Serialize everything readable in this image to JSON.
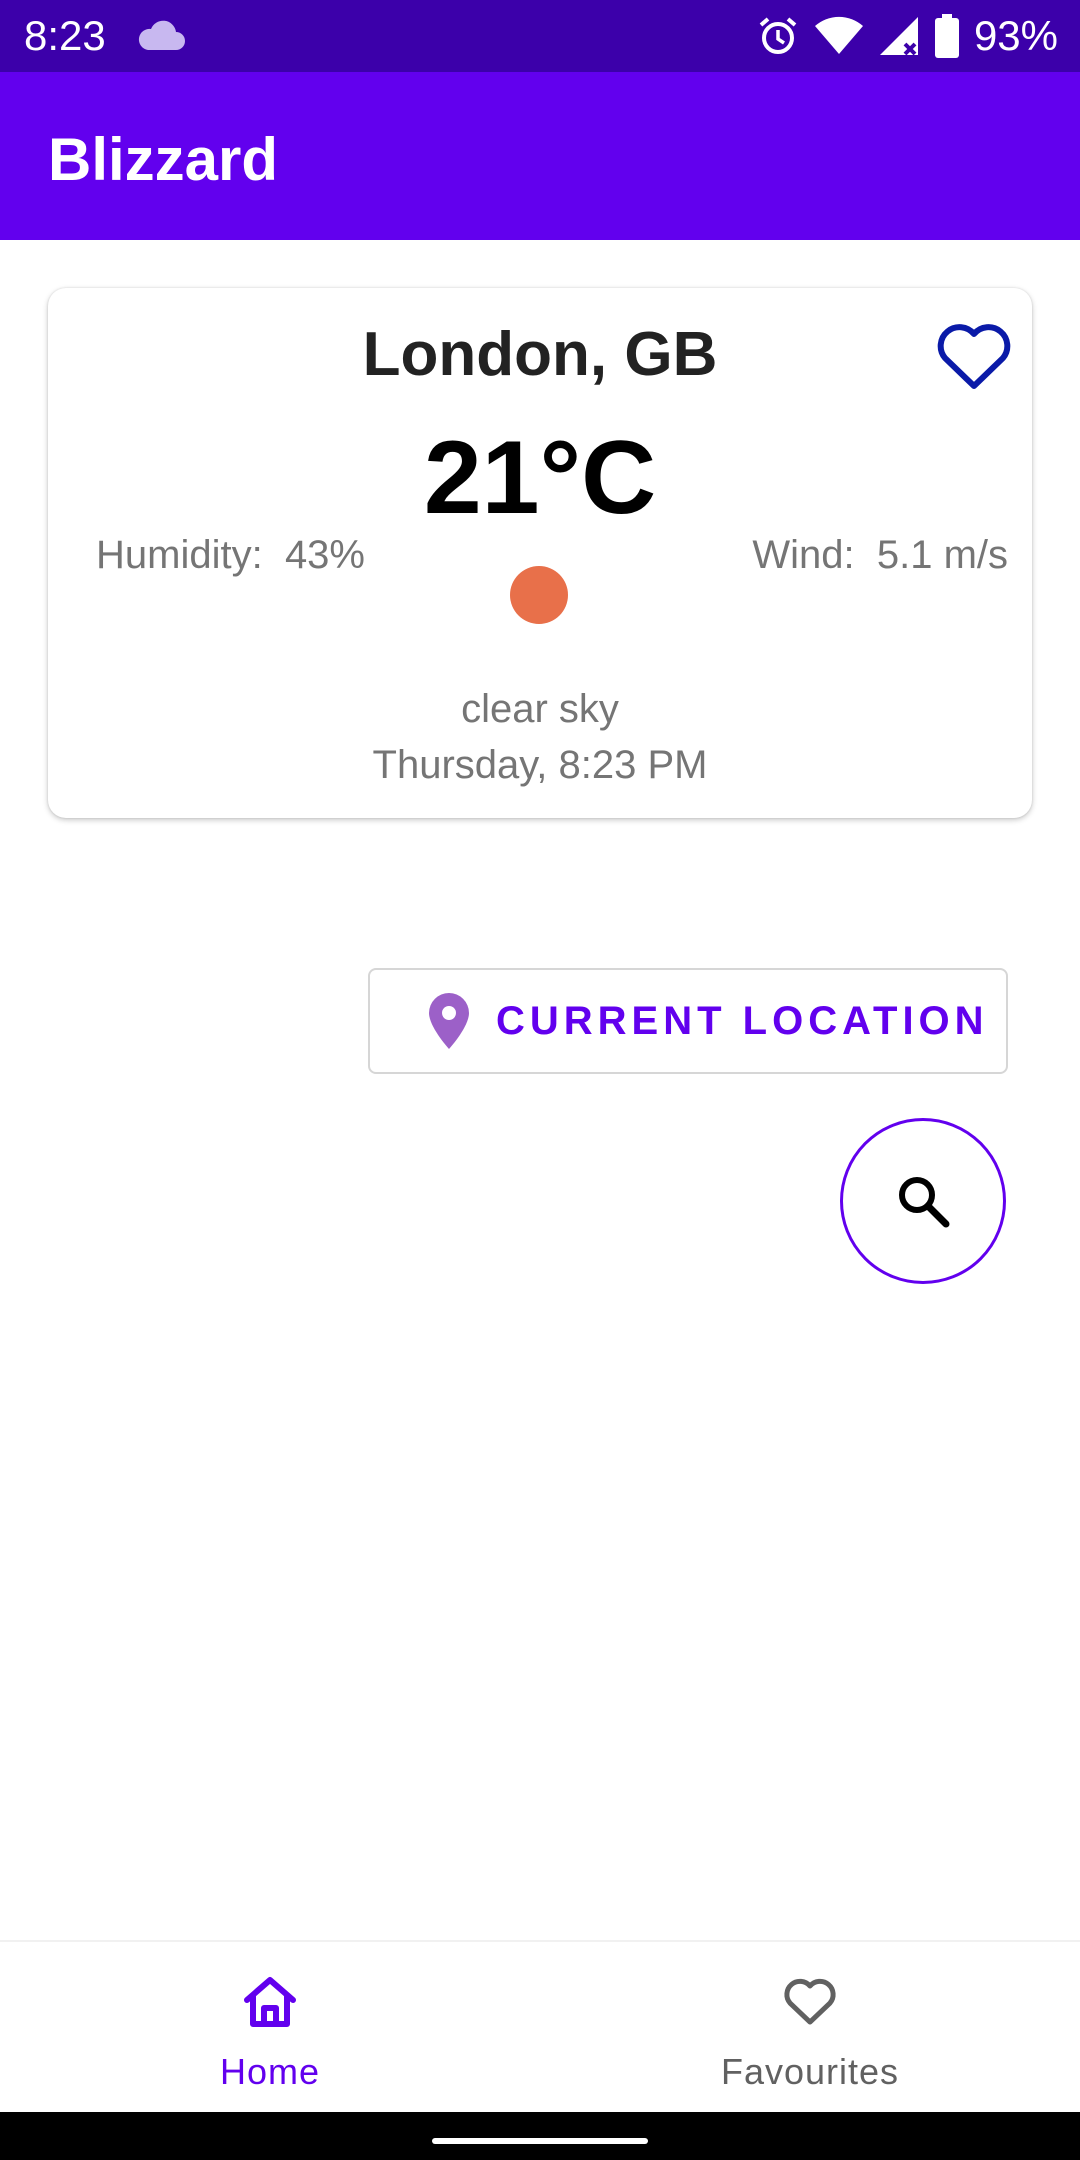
{
  "status_bar": {
    "time": "8:23",
    "battery": "93%",
    "icons": [
      "cloud-icon",
      "alarm-icon",
      "wifi-icon",
      "signal-icon",
      "battery-icon"
    ]
  },
  "app_bar": {
    "title": "Blizzard"
  },
  "weather": {
    "city": "London, GB",
    "temperature": "21°C",
    "humidity_label": "Humidity:",
    "humidity_value": "43%",
    "wind_label": "Wind:",
    "wind_value": "5.1 m/s",
    "description": "clear sky",
    "datetime": "Thursday, 8:23 PM",
    "indicator_color": "#e8704a",
    "favourite_icon": "heart-outline-icon"
  },
  "actions": {
    "current_location_label": "CURRENT LOCATION",
    "location_icon": "location-pin-icon",
    "search_icon": "search-icon"
  },
  "bottom_nav": {
    "items": [
      {
        "label": "Home",
        "icon": "home-icon",
        "selected": true
      },
      {
        "label": "Favourites",
        "icon": "heart-outline-icon",
        "selected": false
      }
    ]
  },
  "colors": {
    "primary": "#6200ee",
    "primary_dark": "#3c00aa",
    "favourite_heart": "#0a1aa8"
  }
}
